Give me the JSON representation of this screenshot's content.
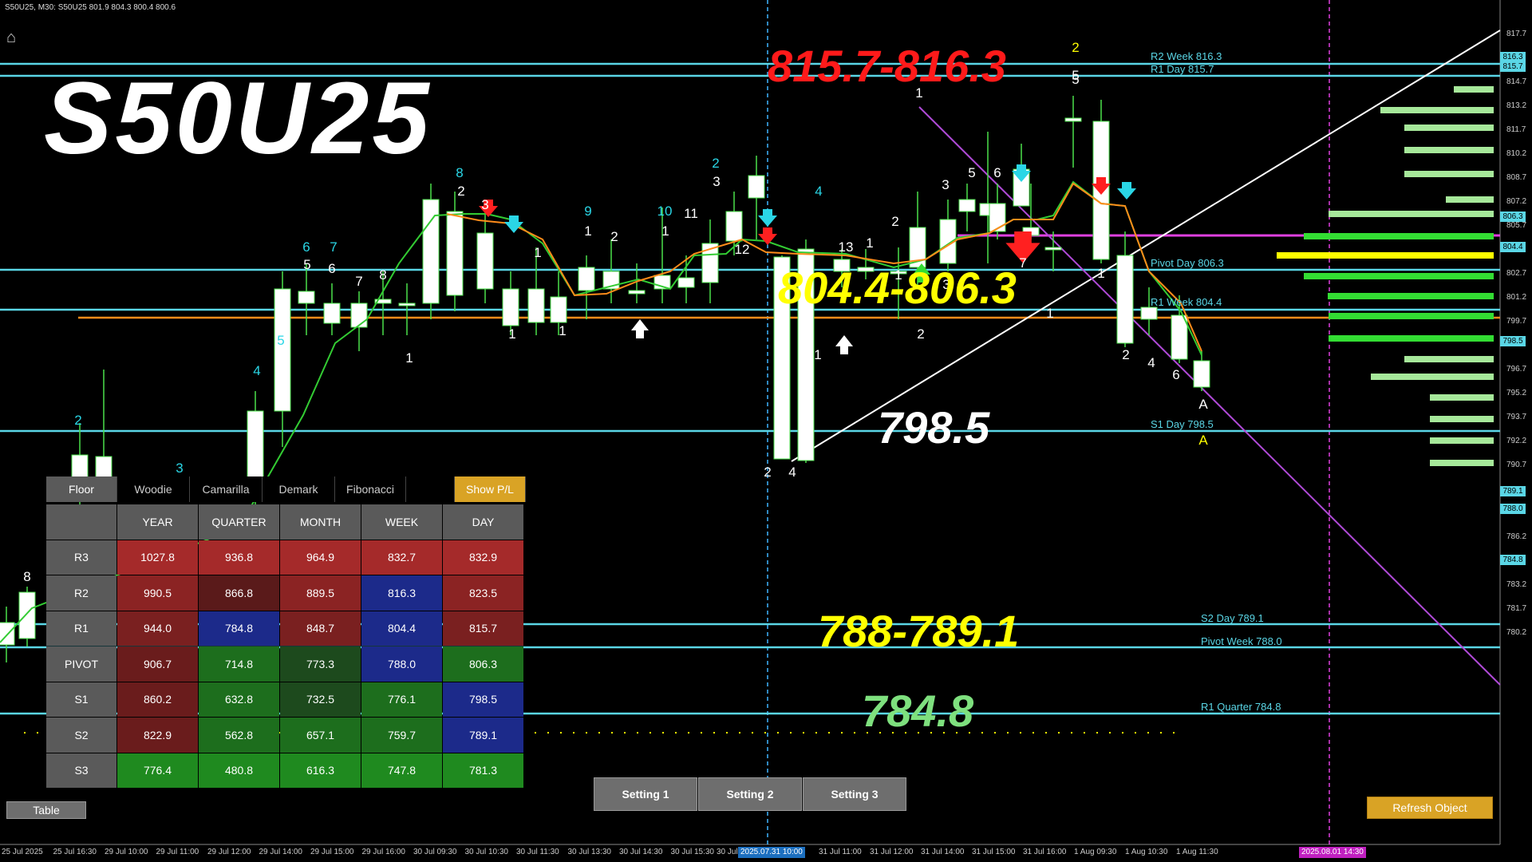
{
  "header": {
    "title": "S50U25, M30:  S50U25  801.9 804.3 800.4 800.6"
  },
  "symbol_title": "S50U25",
  "zones": {
    "upper": "815.7-816.3",
    "middle": "804.4-806.3",
    "s1": "798.5",
    "lower": "788-789.1",
    "quarter": "784.8"
  },
  "level_labels": [
    "R2 Week 816.3",
    "R1 Day 815.7",
    "Pivot Day 806.3",
    "R1 Week 804.4",
    "S1 Day 798.5",
    "S2 Day 789.1",
    "Pivot Week 788.0",
    "R1 Quarter 784.8"
  ],
  "y_axis": {
    "ticks": [
      "817.7",
      "816.3",
      "815.7",
      "814.7",
      "813.2",
      "811.7",
      "810.2",
      "808.7",
      "807.2",
      "806.3",
      "805.7",
      "804.4",
      "802.7",
      "801.2",
      "799.7",
      "798.5",
      "796.7",
      "795.2",
      "793.7",
      "792.2",
      "790.7",
      "789.1",
      "788.0",
      "786.2",
      "784.8",
      "783.2",
      "781.7",
      "780.2"
    ],
    "highlighted": [
      "816.3",
      "815.7",
      "806.3",
      "804.4",
      "798.5",
      "789.1",
      "788.0",
      "784.8"
    ]
  },
  "x_axis": {
    "ticks": [
      "25 Jul 2025",
      "25 Jul 16:30",
      "29 Jul 10:00",
      "29 Jul 11:00",
      "29 Jul 12:00",
      "29 Jul 14:00",
      "29 Jul 15:00",
      "29 Jul 16:00",
      "30 Jul 09:30",
      "30 Jul 10:30",
      "30 Jul 11:30",
      "30 Jul 13:30",
      "30 Jul 14:30",
      "30 Jul 15:30",
      "30 Jul",
      "31 Jul 11:00",
      "31 Jul 12:00",
      "31 Jul 14:00",
      "31 Jul 15:00",
      "31 Jul 16:00",
      "1 Aug 09:30",
      "1 Aug 10:30",
      "1 Aug 11:30"
    ],
    "markers": [
      "2025.07.31 10:00",
      "2025.08.01 14:30"
    ]
  },
  "pivot_table": {
    "tabs": [
      "Floor",
      "Woodie",
      "Camarilla",
      "Demark",
      "Fibonacci"
    ],
    "active_tab": "Floor",
    "show_pl": "Show P/L",
    "columns": [
      "YEAR",
      "QUARTER",
      "MONTH",
      "WEEK",
      "DAY"
    ],
    "rows": [
      {
        "label": "R3",
        "values": [
          "1027.8",
          "936.8",
          "964.9",
          "832.7",
          "832.9"
        ]
      },
      {
        "label": "R2",
        "values": [
          "990.5",
          "866.8",
          "889.5",
          "816.3",
          "823.5"
        ]
      },
      {
        "label": "R1",
        "values": [
          "944.0",
          "784.8",
          "848.7",
          "804.4",
          "815.7"
        ]
      },
      {
        "label": "PIVOT",
        "values": [
          "906.7",
          "714.8",
          "773.3",
          "788.0",
          "806.3"
        ]
      },
      {
        "label": "S1",
        "values": [
          "860.2",
          "632.8",
          "732.5",
          "776.1",
          "798.5"
        ]
      },
      {
        "label": "S2",
        "values": [
          "822.9",
          "562.8",
          "657.1",
          "759.7",
          "789.1"
        ]
      },
      {
        "label": "S3",
        "values": [
          "776.4",
          "480.8",
          "616.3",
          "747.8",
          "781.3"
        ]
      }
    ],
    "cell_colors": [
      [
        "#a52a2a",
        "#a52a2a",
        "#a52a2a",
        "#a52a2a",
        "#a52a2a"
      ],
      [
        "#8b2323",
        "#5a1a1a",
        "#8b2323",
        "#1c2a8a",
        "#8b2323"
      ],
      [
        "#7a2020",
        "#1c2a8a",
        "#7a2020",
        "#1c2a8a",
        "#7a2020"
      ],
      [
        "#6a1c1c",
        "#1d6e1d",
        "#1d4a1d",
        "#1c2a8a",
        "#1d6e1d"
      ],
      [
        "#6a1c1c",
        "#1d6e1d",
        "#1d4a1d",
        "#1d6e1d",
        "#1c2a8a"
      ],
      [
        "#6a1c1c",
        "#1d6e1d",
        "#1d6e1d",
        "#1d6e1d",
        "#1c2a8a"
      ],
      [
        "#1f8a1f",
        "#1f8a1f",
        "#1f8a1f",
        "#1f8a1f",
        "#1f8a1f"
      ]
    ]
  },
  "buttons": {
    "table": "Table",
    "setting1": "Setting 1",
    "setting2": "Setting 2",
    "setting3": "Setting 3",
    "refresh": "Refresh Object"
  },
  "candle_labels": [
    "8",
    "2",
    "3",
    "4",
    "4",
    "5",
    "5",
    "6",
    "6",
    "7",
    "7",
    "8",
    "1",
    "8",
    "2",
    "3",
    "1",
    "1",
    "1",
    "9",
    "1",
    "2",
    "10",
    "1",
    "11",
    "2",
    "3",
    "12",
    "4",
    "13",
    "1",
    "2",
    "3",
    "4",
    "1",
    "2",
    "1",
    "3",
    "5",
    "6",
    "7",
    "1",
    "2",
    "5",
    "5",
    "1",
    "2",
    "4",
    "6",
    "A",
    "A",
    "1",
    "2"
  ],
  "colors": {
    "level": "#5ad6e6",
    "red": "#ff1a1a",
    "yellow": "#ffff00",
    "green": "#7ee07e",
    "orange": "#ff8c1a",
    "magenta": "#e040e0",
    "purple": "#b04ad8"
  }
}
